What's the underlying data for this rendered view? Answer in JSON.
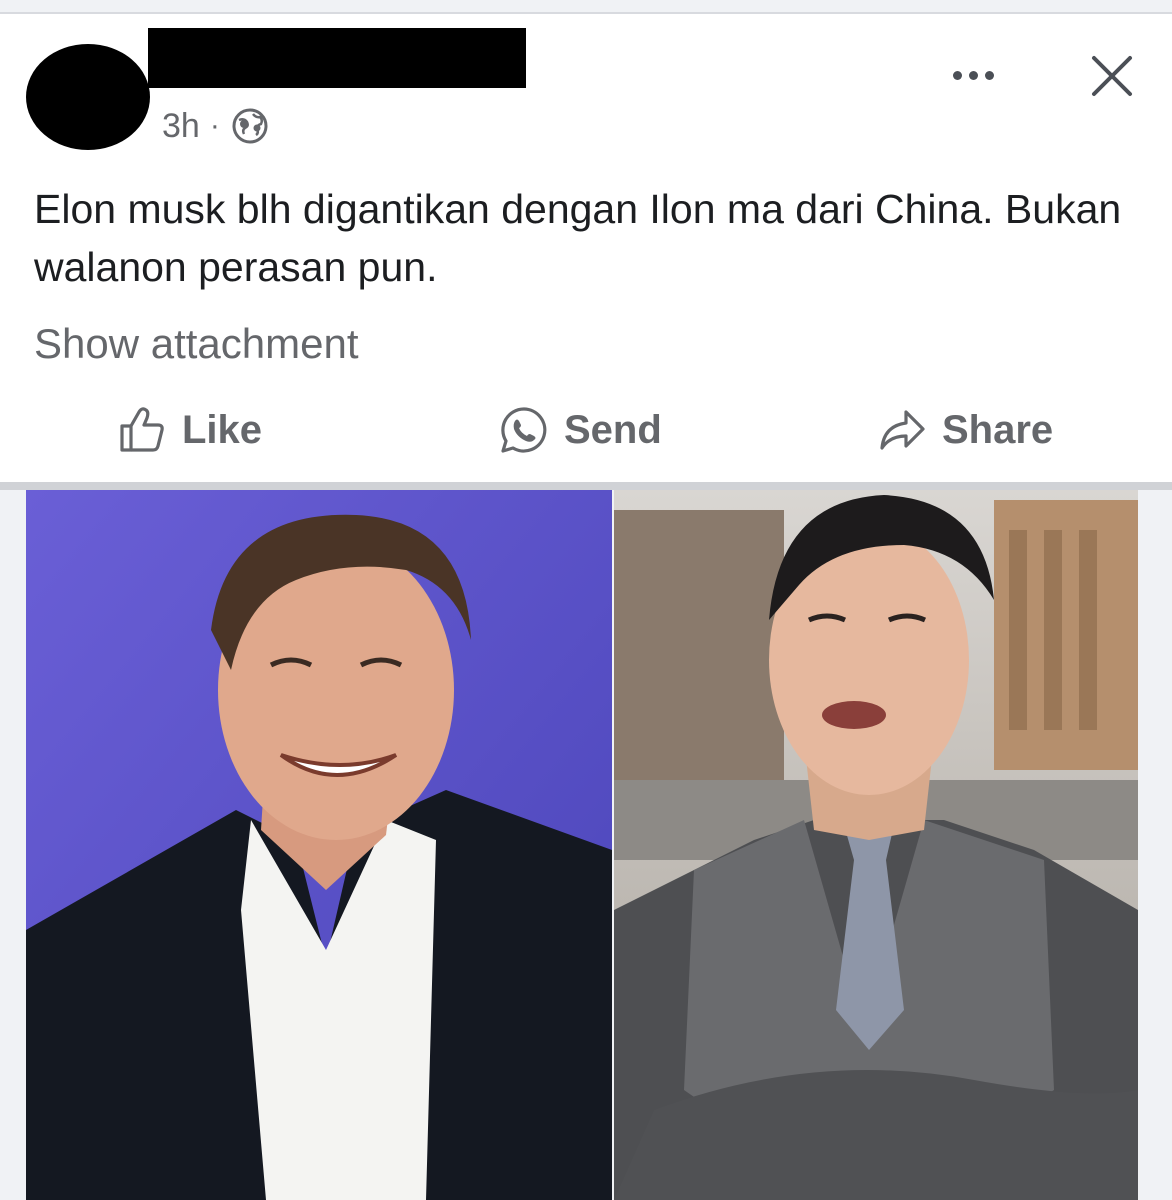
{
  "post": {
    "timestamp": "3h",
    "separator": "·",
    "privacy_icon": "globe-icon",
    "text": "Elon musk blh digantikan dengan Ilon ma dari China. Bukan walanon perasan pun.",
    "show_attachment_label": "Show attachment"
  },
  "actions": {
    "like_label": "Like",
    "send_label": "Send",
    "share_label": "Share"
  },
  "header_icons": [
    "more-options-icon",
    "close-icon"
  ],
  "colors": {
    "text_primary": "#1c1e21",
    "text_secondary": "#65676b",
    "background": "#ffffff",
    "divider": "#d0d2d6"
  }
}
